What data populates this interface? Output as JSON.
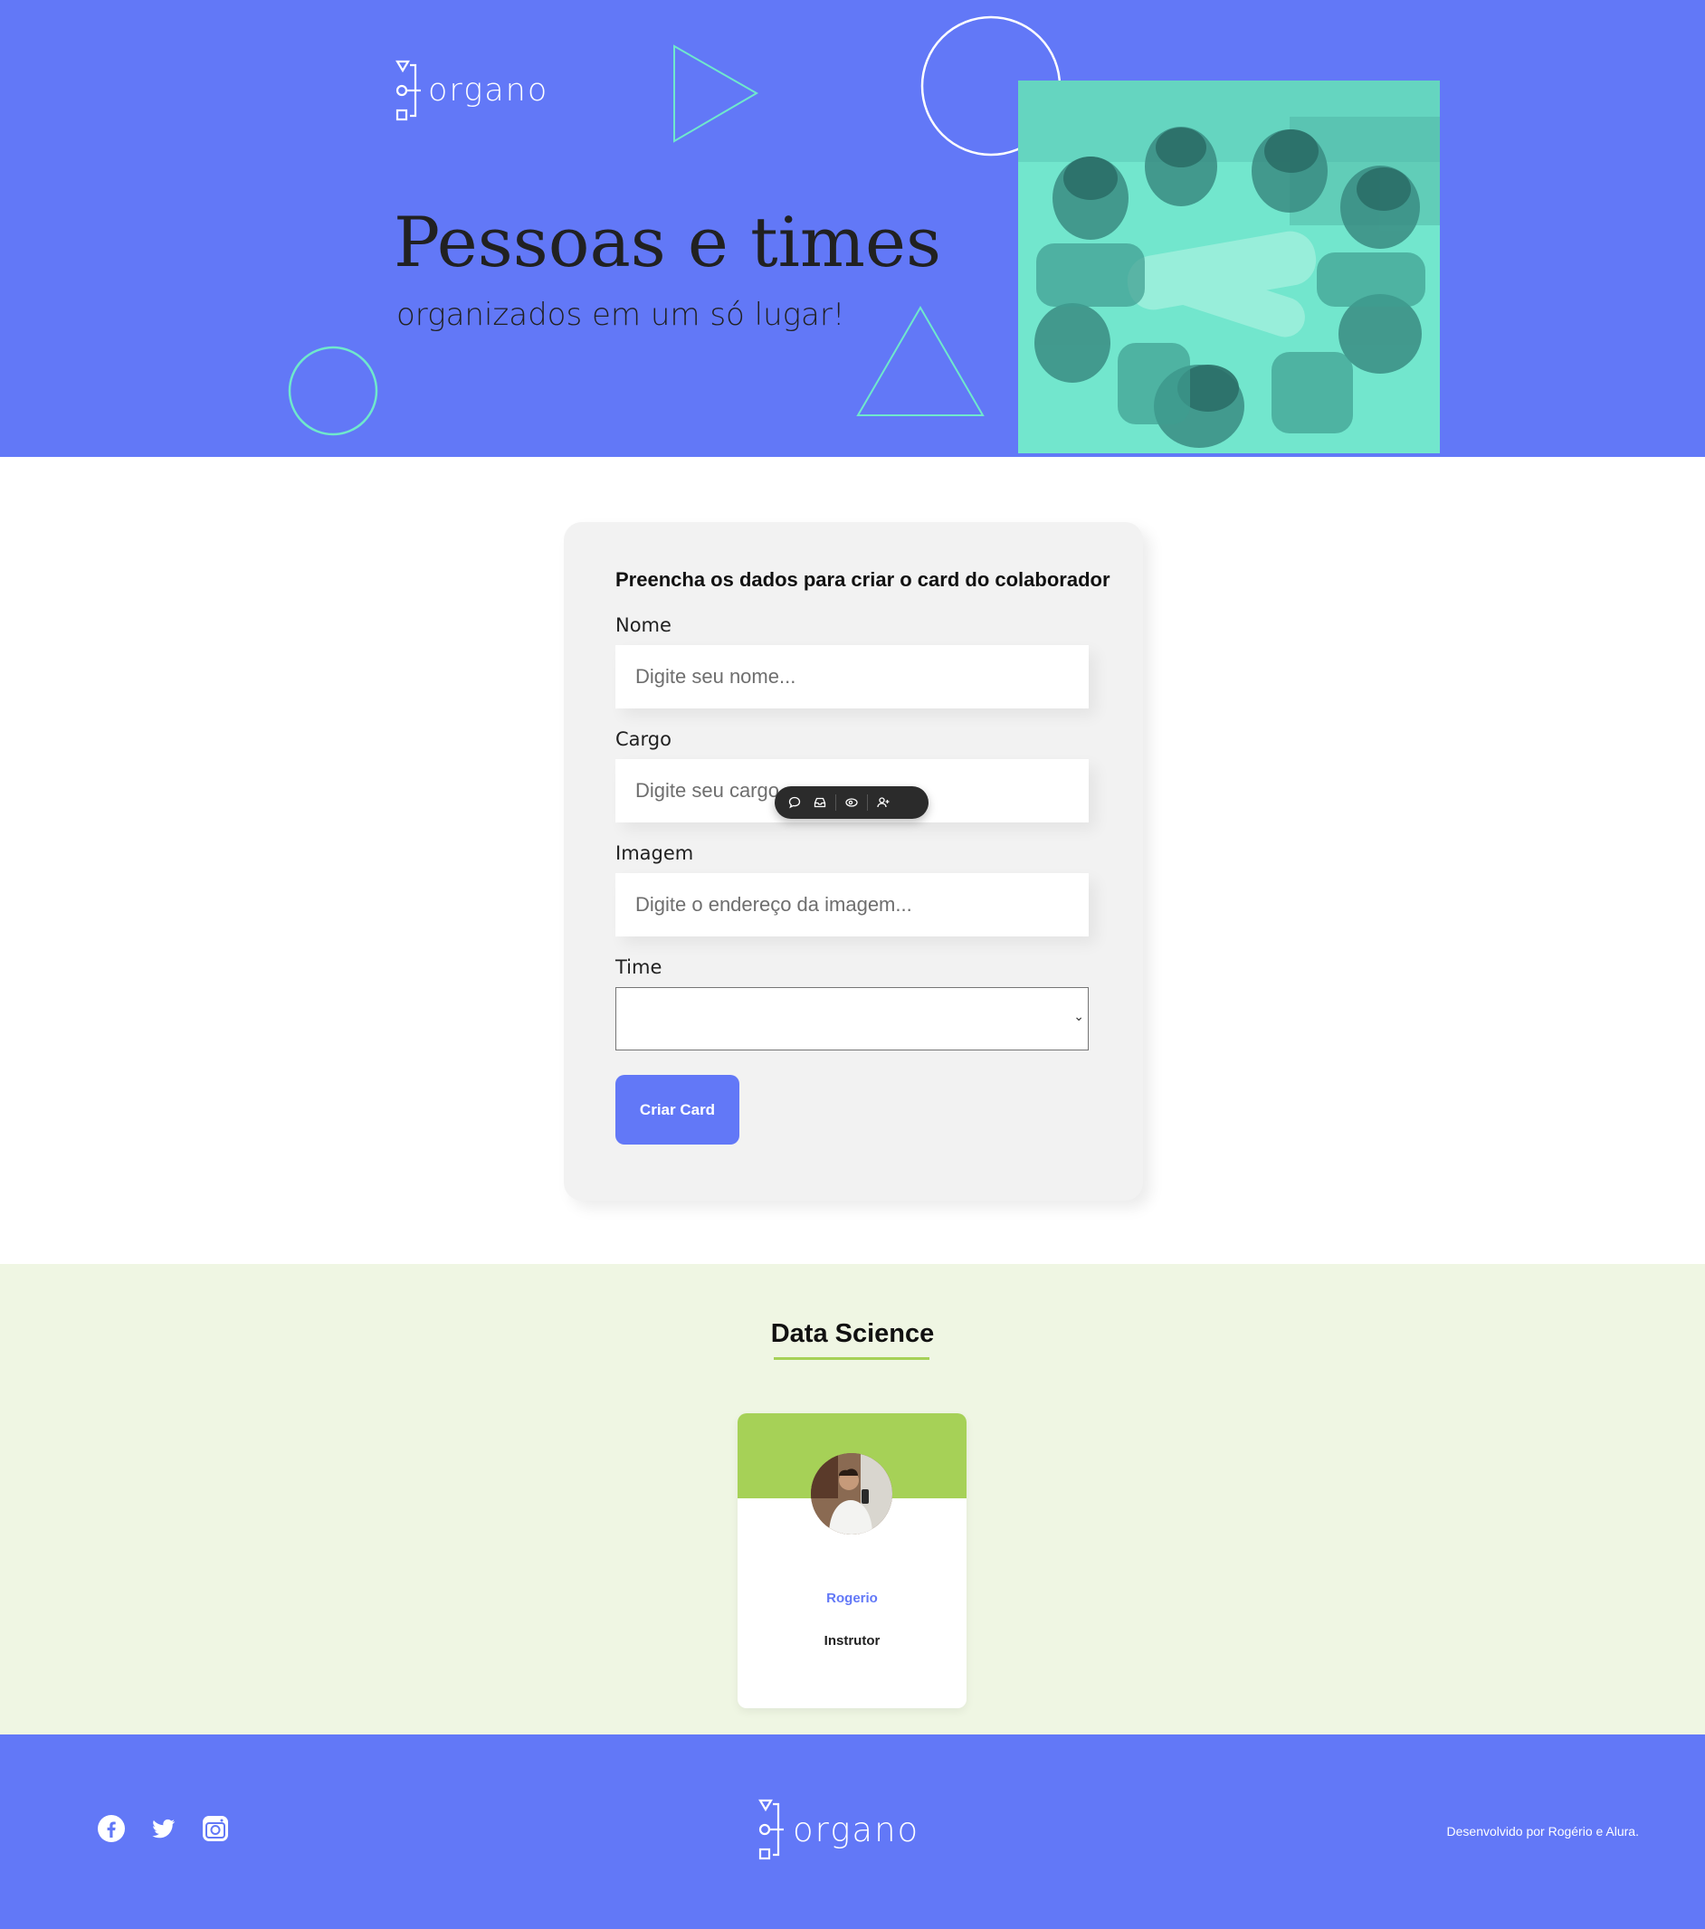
{
  "brand": {
    "name": "organo"
  },
  "hero": {
    "title": "Pessoas e times",
    "subtitle": "organizados em um só lugar!"
  },
  "form": {
    "heading": "Preencha os dados para criar o card do colaborador",
    "fields": {
      "nome": {
        "label": "Nome",
        "placeholder": "Digite seu nome..."
      },
      "cargo": {
        "label": "Cargo",
        "placeholder": "Digite seu cargo..."
      },
      "imagem": {
        "label": "Imagem",
        "placeholder": "Digite o endereço da imagem..."
      },
      "time": {
        "label": "Time",
        "value": ""
      }
    },
    "submit_label": "Criar Card"
  },
  "floating_toolbar": {
    "icons": [
      "comment-icon",
      "inbox-icon",
      "eye-icon",
      "add-user-icon"
    ]
  },
  "teams": [
    {
      "name": "Data Science",
      "primary_color": "#a6d157",
      "secondary_color": "#eff6e3",
      "members": [
        {
          "name": "Rogerio",
          "role": "Instrutor"
        }
      ]
    }
  ],
  "footer": {
    "social": [
      "facebook-icon",
      "twitter-icon",
      "instagram-icon"
    ],
    "credit": "Desenvolvido por Rogério e Alura."
  },
  "colors": {
    "brand_blue": "#6278f7",
    "accent_teal": "#6fe8cc",
    "text_dark": "#212121",
    "form_bg": "#f2f2f2"
  }
}
